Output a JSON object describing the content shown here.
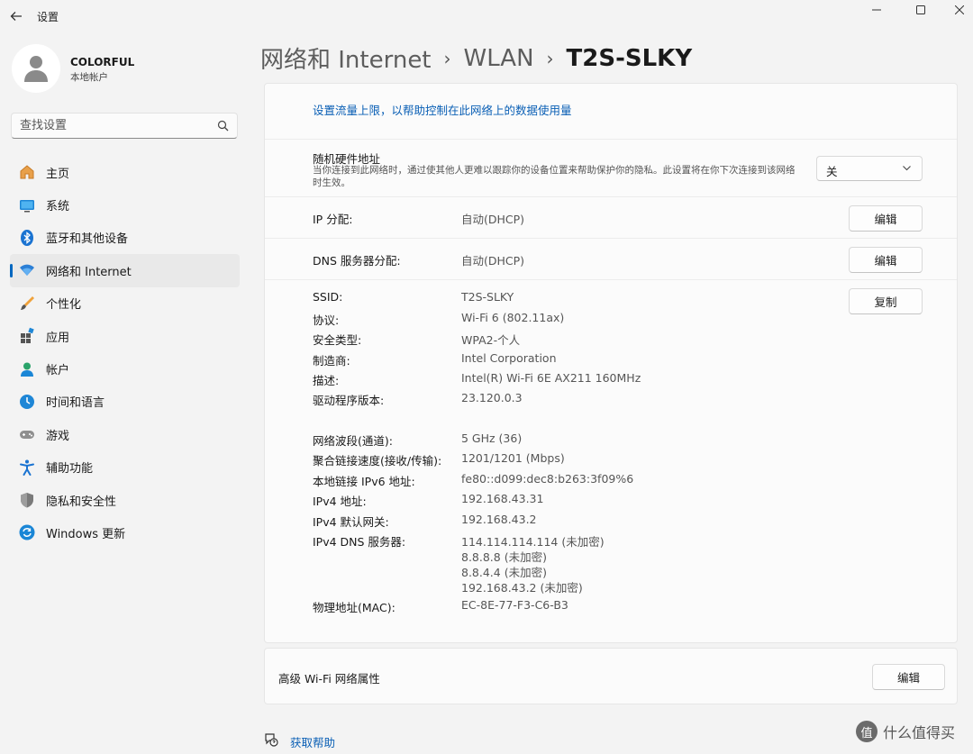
{
  "window": {
    "title": "设置",
    "minimize": "—",
    "maximize": "☐",
    "close": "✕"
  },
  "user": {
    "name": "COLORFUL",
    "account_type": "本地帐户"
  },
  "search": {
    "placeholder": "查找设置"
  },
  "sidebar": {
    "items": [
      {
        "label": "主页",
        "icon": "home-icon"
      },
      {
        "label": "系统",
        "icon": "system-icon"
      },
      {
        "label": "蓝牙和其他设备",
        "icon": "bluetooth-icon"
      },
      {
        "label": "网络和 Internet",
        "icon": "wifi-icon",
        "active": true
      },
      {
        "label": "个性化",
        "icon": "brush-icon"
      },
      {
        "label": "应用",
        "icon": "apps-icon"
      },
      {
        "label": "帐户",
        "icon": "account-icon"
      },
      {
        "label": "时间和语言",
        "icon": "clock-globe-icon"
      },
      {
        "label": "游戏",
        "icon": "gamepad-icon"
      },
      {
        "label": "辅助功能",
        "icon": "accessibility-icon"
      },
      {
        "label": "隐私和安全性",
        "icon": "shield-icon"
      },
      {
        "label": "Windows 更新",
        "icon": "update-icon"
      }
    ]
  },
  "breadcrumb": {
    "part1": "网络和 Internet",
    "part2": "WLAN",
    "current": "T2S-SLKY",
    "sep": "›"
  },
  "main": {
    "data_limit_link": "设置流量上限，以帮助控制在此网络上的数据使用量",
    "random_mac": {
      "label": "随机硬件地址",
      "desc": "当你连接到此网络时，通过使其他人更难以跟踪你的设备位置来帮助保护你的隐私。此设置将在你下次连接到该网络时生效。",
      "value": "关"
    },
    "ip_assignment": {
      "label": "IP 分配:",
      "value": "自动(DHCP)",
      "button": "编辑"
    },
    "dns_assignment": {
      "label": "DNS 服务器分配:",
      "value": "自动(DHCP)",
      "button": "编辑"
    },
    "copy_button": "复制",
    "properties": [
      {
        "label": "SSID:",
        "value": "T2S-SLKY"
      },
      {
        "label": "协议:",
        "value": "Wi-Fi 6 (802.11ax)"
      },
      {
        "label": "安全类型:",
        "value": "WPA2-个人"
      },
      {
        "label": "制造商:",
        "value": "Intel Corporation"
      },
      {
        "label": "描述:",
        "value": "Intel(R) Wi-Fi 6E AX211 160MHz"
      },
      {
        "label": "驱动程序版本:",
        "value": "23.120.0.3"
      },
      {
        "label": "网络波段(通道):",
        "value": "5 GHz (36)"
      },
      {
        "label": "聚合链接速度(接收/传输):",
        "value": "1201/1201 (Mbps)"
      },
      {
        "label": "本地链接 IPv6 地址:",
        "value": "fe80::d099:dec8:b263:3f09%6"
      },
      {
        "label": "IPv4 地址:",
        "value": "192.168.43.31"
      },
      {
        "label": "IPv4 默认网关:",
        "value": "192.168.43.2"
      },
      {
        "label": "IPv4 DNS 服务器:",
        "value": "114.114.114.114 (未加密)"
      },
      {
        "label": "",
        "value": "8.8.8.8 (未加密)"
      },
      {
        "label": "",
        "value": "8.8.4.4 (未加密)"
      },
      {
        "label": "",
        "value": "192.168.43.2 (未加密)"
      },
      {
        "label": "物理地址(MAC):",
        "value": "EC-8E-77-F3-C6-B3"
      }
    ],
    "advanced": {
      "label": "高级 Wi-Fi 网络属性",
      "button": "编辑"
    },
    "help_link": "获取帮助"
  },
  "watermark": {
    "text": "什么值得买",
    "badge": "值"
  },
  "colors": {
    "accent": "#0067c0",
    "link": "#0a5fb5",
    "background": "#f3f3f3"
  }
}
